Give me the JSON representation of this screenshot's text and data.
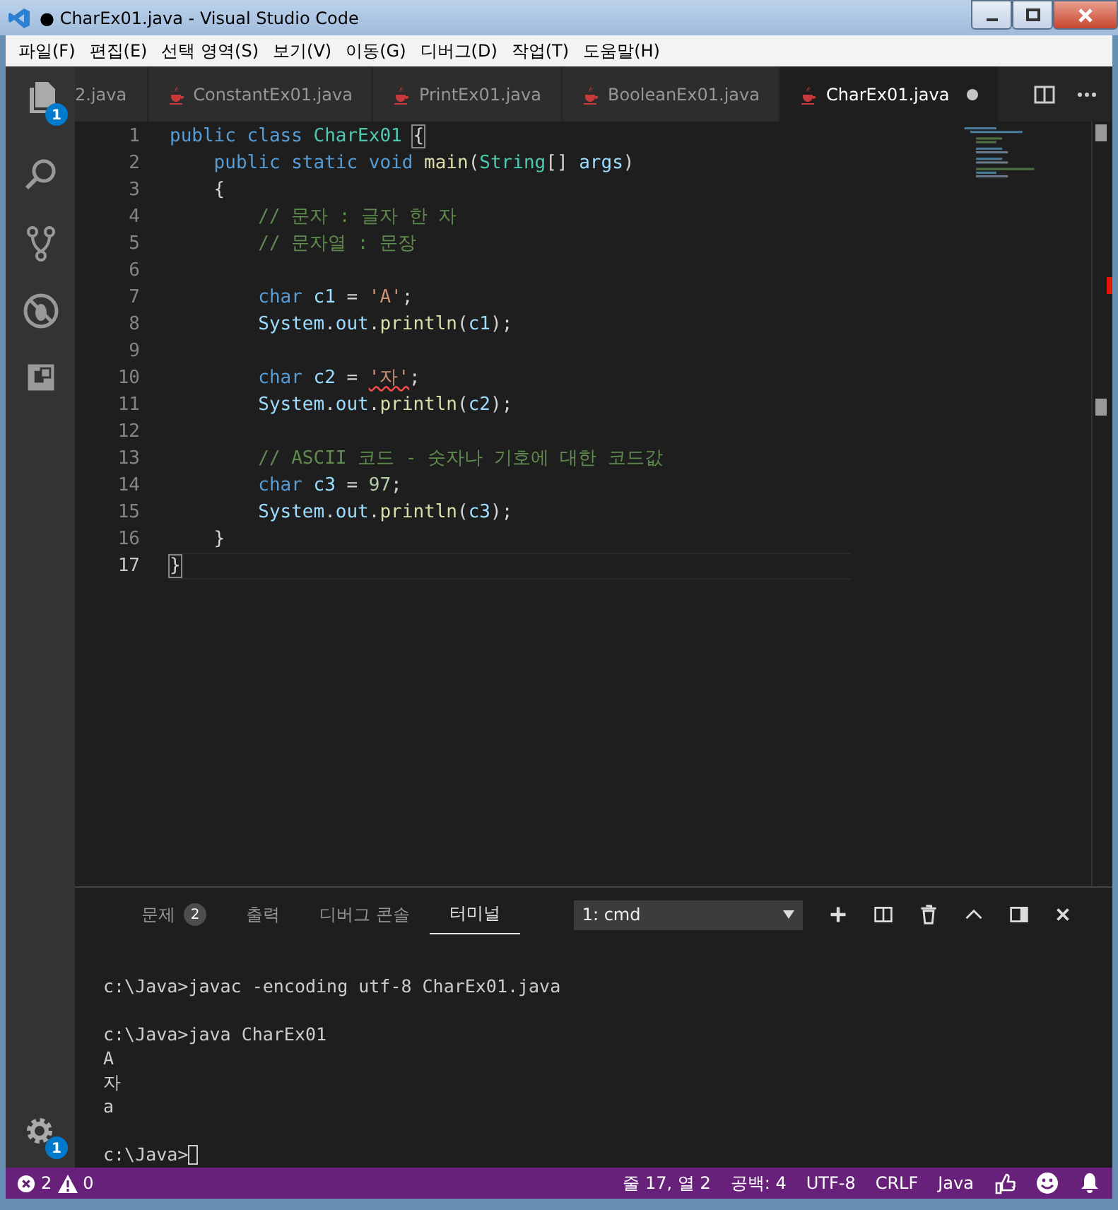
{
  "window": {
    "title": "CharEx01.java - Visual Studio Code",
    "unsaved_mark": "●"
  },
  "menu": [
    "파일(F)",
    "편집(E)",
    "선택 영역(S)",
    "보기(V)",
    "이동(G)",
    "디버그(D)",
    "작업(T)",
    "도움말(H)"
  ],
  "activity_bar": {
    "explorer_badge": "1",
    "settings_badge": "1"
  },
  "tabs": [
    {
      "label": "2.java",
      "icon": false,
      "selected": false,
      "dirty": false
    },
    {
      "label": "ConstantEx01.java",
      "icon": true,
      "selected": false,
      "dirty": false
    },
    {
      "label": "PrintEx01.java",
      "icon": true,
      "selected": false,
      "dirty": false
    },
    {
      "label": "BooleanEx01.java",
      "icon": true,
      "selected": false,
      "dirty": false
    },
    {
      "label": "CharEx01.java",
      "icon": true,
      "selected": true,
      "dirty": true
    }
  ],
  "editor": {
    "lines": [
      {
        "number": "1",
        "current": false,
        "tokens": [
          {
            "t": "public class",
            "kind": "kw"
          },
          {
            "t": "CharEx01",
            "kind": "type"
          },
          {
            "t": "{",
            "kind": "bracket"
          }
        ]
      },
      {
        "number": "2",
        "current": false,
        "tokens": [
          {
            "t": "    public static void",
            "kind": "kw"
          },
          {
            "t": "main",
            "kind": "fn"
          },
          {
            "t": "(",
            "kind": "plain"
          },
          {
            "t": "String",
            "kind": "type"
          },
          {
            "t": "[]",
            "kind": "plain"
          },
          {
            "t": "args",
            "kind": "var"
          },
          {
            "t": ")",
            "kind": "plain"
          }
        ]
      },
      {
        "number": "3",
        "current": false,
        "tokens": [
          {
            "t": "    {",
            "kind": "plain"
          }
        ]
      },
      {
        "number": "4",
        "current": false,
        "tokens": [
          {
            "t": "        // 문자 : 글자 한 자",
            "kind": "comment"
          }
        ]
      },
      {
        "number": "5",
        "current": false,
        "tokens": [
          {
            "t": "        // 문자열 : 문장",
            "kind": "comment"
          }
        ]
      },
      {
        "number": "6",
        "current": false
      },
      {
        "number": "7",
        "current": false,
        "tokens": [
          {
            "t": "        char",
            "kind": "kw"
          },
          {
            "t": "c1",
            "kind": "var"
          },
          {
            "t": "=",
            "kind": "plain"
          },
          {
            "t": "'A'",
            "kind": "str"
          },
          {
            "t": ";",
            "kind": "plain"
          }
        ]
      },
      {
        "number": "8",
        "current": false,
        "tokens": [
          {
            "t": "        System",
            "kind": "var"
          },
          {
            "t": ".",
            "kind": "plain"
          },
          {
            "t": "out",
            "kind": "var"
          },
          {
            "t": ".",
            "kind": "plain"
          },
          {
            "t": "println",
            "kind": "fn"
          },
          {
            "t": "(",
            "kind": "plain"
          },
          {
            "t": "c1",
            "kind": "var"
          },
          {
            "t": ");",
            "kind": "plain"
          }
        ]
      },
      {
        "number": "9",
        "current": false
      },
      {
        "number": "10",
        "current": false,
        "tokens": [
          {
            "t": "        char",
            "kind": "kw"
          },
          {
            "t": "c2",
            "kind": "var"
          },
          {
            "t": "=",
            "kind": "plain"
          },
          {
            "t": "'자'",
            "kind": "error"
          },
          {
            "t": ";",
            "kind": "plain"
          }
        ]
      },
      {
        "number": "11",
        "current": false,
        "tokens": [
          {
            "t": "        System",
            "kind": "var"
          },
          {
            "t": ".",
            "kind": "plain"
          },
          {
            "t": "out",
            "kind": "var"
          },
          {
            "t": ".",
            "kind": "plain"
          },
          {
            "t": "println",
            "kind": "fn"
          },
          {
            "t": "(",
            "kind": "plain"
          },
          {
            "t": "c2",
            "kind": "var"
          },
          {
            "t": ");",
            "kind": "plain"
          }
        ]
      },
      {
        "number": "12",
        "current": false
      },
      {
        "number": "13",
        "current": false,
        "tokens": [
          {
            "t": "        // ASCII 코드 - 숫자나 기호에 대한 코드값",
            "kind": "comment"
          }
        ]
      },
      {
        "number": "14",
        "current": false,
        "tokens": [
          {
            "t": "        char",
            "kind": "kw"
          },
          {
            "t": "c3",
            "kind": "var"
          },
          {
            "t": "=",
            "kind": "plain"
          },
          {
            "t": "97",
            "kind": "num"
          },
          {
            "t": ";",
            "kind": "plain"
          }
        ]
      },
      {
        "number": "15",
        "current": false,
        "tokens": [
          {
            "t": "        System",
            "kind": "var"
          },
          {
            "t": ".",
            "kind": "plain"
          },
          {
            "t": "out",
            "kind": "var"
          },
          {
            "t": ".",
            "kind": "plain"
          },
          {
            "t": "println",
            "kind": "fn"
          },
          {
            "t": "(",
            "kind": "plain"
          },
          {
            "t": "c3",
            "kind": "var"
          },
          {
            "t": ");",
            "kind": "plain"
          }
        ]
      },
      {
        "number": "16",
        "current": false,
        "tokens": [
          {
            "t": "    }",
            "kind": "plain"
          }
        ]
      },
      {
        "number": "17",
        "current": true,
        "tokens": [
          {
            "t": "}",
            "kind": "bracket"
          }
        ]
      }
    ]
  },
  "panel": {
    "tabs": [
      {
        "label": "문제",
        "badge": "2",
        "selected": false
      },
      {
        "label": "출력",
        "selected": false
      },
      {
        "label": "디버그 콘솔",
        "selected": false
      },
      {
        "label": "터미널",
        "selected": true
      }
    ],
    "terminal_select": "1: cmd",
    "terminal_blocks": [
      [
        "c:\\Java>javac -encoding utf-8 CharEx01.java"
      ],
      [
        "c:\\Java>java CharEx01",
        "A",
        "자",
        "a"
      ],
      [
        "c:\\Java>"
      ]
    ]
  },
  "status_bar": {
    "errors": "2",
    "warnings": "0",
    "position": "줄 17, 열 2",
    "indent": "공백: 4",
    "encoding": "UTF-8",
    "eol": "CRLF",
    "language": "Java"
  }
}
